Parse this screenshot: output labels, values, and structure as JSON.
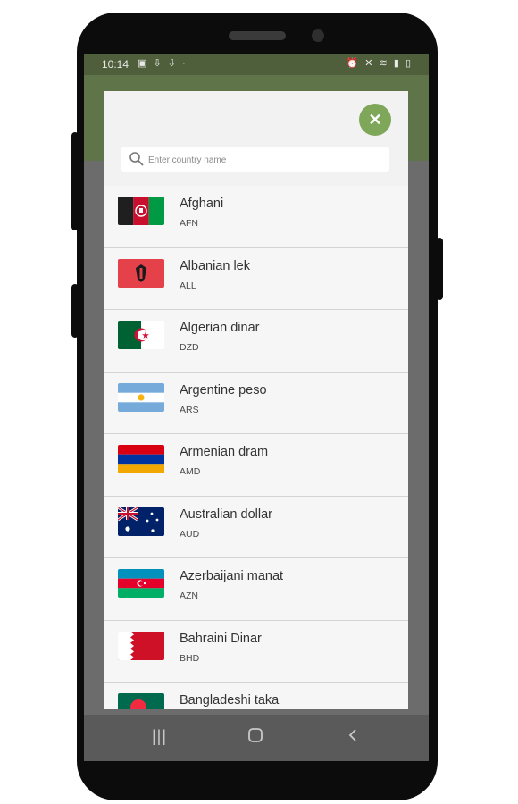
{
  "status_bar": {
    "time": "10:14",
    "left_icons": [
      "image-icon",
      "download-icon",
      "download-icon",
      "dot-icon"
    ],
    "right_icons": [
      "alarm-icon",
      "mute-icon",
      "wifi-icon",
      "signal-icon",
      "battery-icon"
    ]
  },
  "modal": {
    "close_label": "✕",
    "search": {
      "placeholder": "Enter country name",
      "value": ""
    },
    "currencies": [
      {
        "name": "Afghani",
        "code": "AFN",
        "flag": "afghanistan-flag"
      },
      {
        "name": "Albanian lek",
        "code": "ALL",
        "flag": "albania-flag"
      },
      {
        "name": "Algerian dinar",
        "code": "DZD",
        "flag": "algeria-flag"
      },
      {
        "name": "Argentine peso",
        "code": "ARS",
        "flag": "argentina-flag"
      },
      {
        "name": "Armenian dram",
        "code": "AMD",
        "flag": "armenia-flag"
      },
      {
        "name": "Australian dollar",
        "code": "AUD",
        "flag": "australia-flag"
      },
      {
        "name": "Azerbaijani manat",
        "code": "AZN",
        "flag": "azerbaijan-flag"
      },
      {
        "name": "Bahraini Dinar",
        "code": "BHD",
        "flag": "bahrain-flag"
      },
      {
        "name": "Bangladeshi taka",
        "code": "",
        "flag": "bangladesh-flag"
      }
    ]
  },
  "nav_bar": {
    "recents": "recents-icon",
    "home": "home-icon",
    "back": "back-icon"
  },
  "colors": {
    "accent": "#7fa75a",
    "app_bar": "#5f7448",
    "status_bar": "#4f5e3b"
  }
}
